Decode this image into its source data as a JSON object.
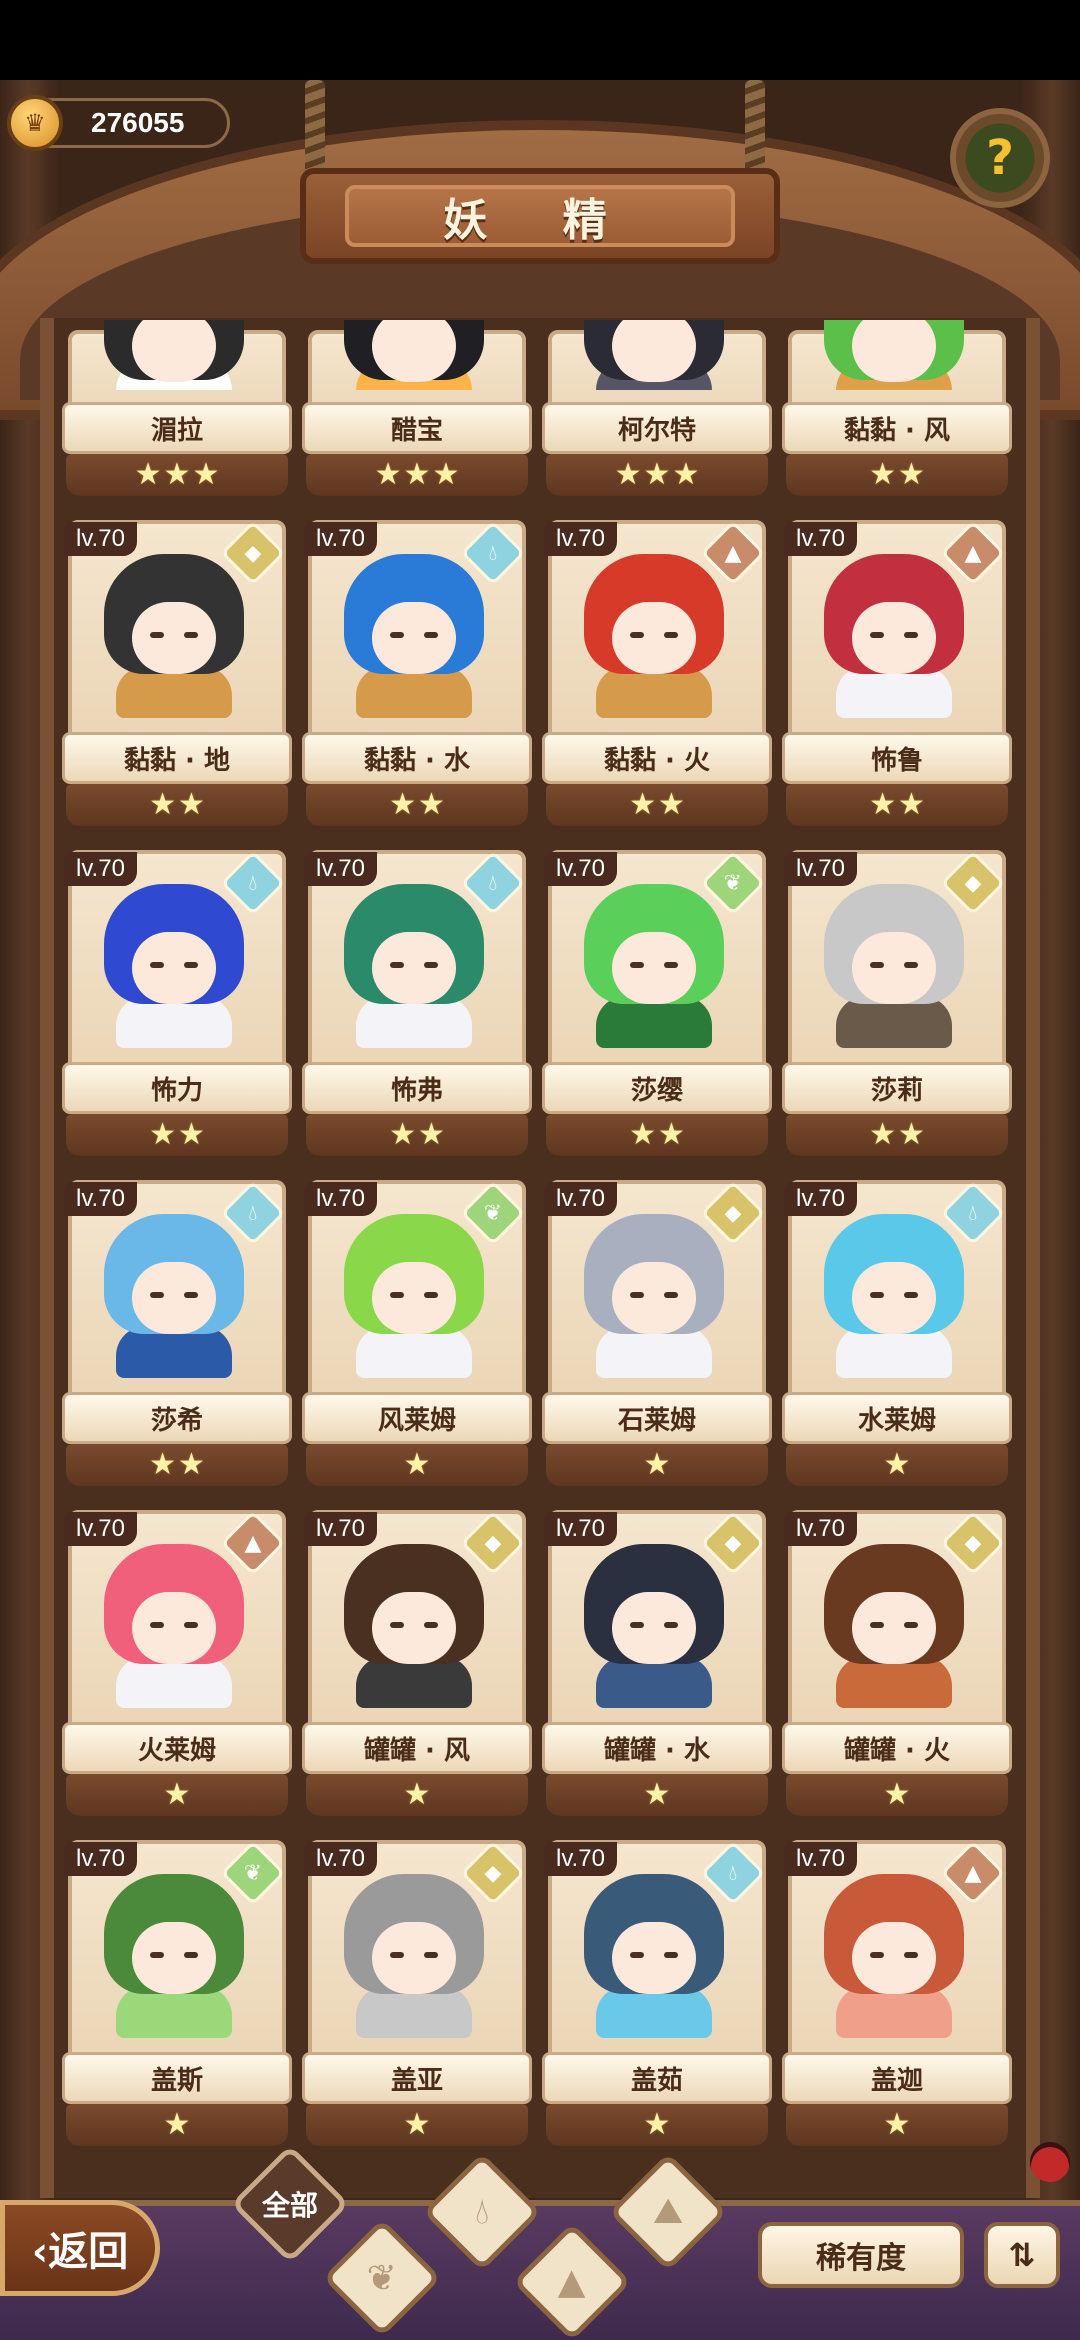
{
  "header": {
    "coins": "276055",
    "title": "妖 精",
    "help_label": "?"
  },
  "fairies": [
    {
      "name": "湄拉",
      "stars": 3,
      "partial": true,
      "hair": "#2b2b2b",
      "body": "#ffffff"
    },
    {
      "name": "醋宝",
      "stars": 3,
      "partial": true,
      "hair": "#1f1f24",
      "body": "#ffb347"
    },
    {
      "name": "柯尔特",
      "stars": 3,
      "partial": true,
      "hair": "#2b2b35",
      "body": "#555566"
    },
    {
      "name": "黏黏 · 风",
      "stars": 2,
      "partial": true,
      "hair": "#5cbf4a",
      "body": "#e0a04a"
    },
    {
      "name": "黏黏 · 地",
      "stars": 2,
      "level": "lv.70",
      "element": "earth",
      "hair": "#333333",
      "body": "#d59a4a"
    },
    {
      "name": "黏黏 · 水",
      "stars": 2,
      "level": "lv.70",
      "element": "water",
      "hair": "#2a7ad8",
      "body": "#d59a4a"
    },
    {
      "name": "黏黏 · 火",
      "stars": 2,
      "level": "lv.70",
      "element": "fire",
      "hair": "#d83a2a",
      "body": "#d59a4a"
    },
    {
      "name": "怖鲁",
      "stars": 2,
      "level": "lv.70",
      "element": "fire",
      "hair": "#c23040",
      "body": "#f4f4f8"
    },
    {
      "name": "怖力",
      "stars": 2,
      "level": "lv.70",
      "element": "water",
      "hair": "#2f4ad0",
      "body": "#f4f4f8"
    },
    {
      "name": "怖弗",
      "stars": 2,
      "level": "lv.70",
      "element": "water",
      "hair": "#2a8a6a",
      "body": "#f4f4f8"
    },
    {
      "name": "莎缨",
      "stars": 2,
      "level": "lv.70",
      "element": "wind",
      "hair": "#5ad05a",
      "body": "#2a7a3a"
    },
    {
      "name": "莎莉",
      "stars": 2,
      "level": "lv.70",
      "element": "earth",
      "hair": "#c8c8c8",
      "body": "#6a5a4a"
    },
    {
      "name": "莎希",
      "stars": 2,
      "level": "lv.70",
      "element": "water",
      "hair": "#6ab8e8",
      "body": "#2a5aa8"
    },
    {
      "name": "风莱姆",
      "stars": 1,
      "level": "lv.70",
      "element": "wind",
      "hair": "#8ad84a",
      "body": "#f4f4f8"
    },
    {
      "name": "石莱姆",
      "stars": 1,
      "level": "lv.70",
      "element": "earth",
      "hair": "#a8b0c0",
      "body": "#f4f4f8"
    },
    {
      "name": "水莱姆",
      "stars": 1,
      "level": "lv.70",
      "element": "water",
      "hair": "#5ac8e8",
      "body": "#f4f4f8"
    },
    {
      "name": "火莱姆",
      "stars": 1,
      "level": "lv.70",
      "element": "fire",
      "hair": "#f0607a",
      "body": "#f4f4f8"
    },
    {
      "name": "罐罐 · 风",
      "stars": 1,
      "level": "lv.70",
      "element": "earth",
      "hair": "#4a3020",
      "body": "#3a3a3a"
    },
    {
      "name": "罐罐 · 水",
      "stars": 1,
      "level": "lv.70",
      "element": "earth",
      "hair": "#2a3040",
      "body": "#3a5a8a"
    },
    {
      "name": "罐罐 · 火",
      "stars": 1,
      "level": "lv.70",
      "element": "earth",
      "hair": "#6a3a20",
      "body": "#c86a3a"
    },
    {
      "name": "盖斯",
      "stars": 1,
      "level": "lv.70",
      "element": "wind",
      "hair": "#4a8a3a",
      "body": "#9ad87a"
    },
    {
      "name": "盖亚",
      "stars": 1,
      "level": "lv.70",
      "element": "earth",
      "hair": "#9a9a9a",
      "body": "#c8c8c8"
    },
    {
      "name": "盖茹",
      "stars": 1,
      "level": "lv.70",
      "element": "water",
      "hair": "#3a5a7a",
      "body": "#6ac8e8"
    },
    {
      "name": "盖迦",
      "stars": 1,
      "level": "lv.70",
      "element": "fire",
      "hair": "#c85a3a",
      "body": "#f0a08a"
    }
  ],
  "bottom": {
    "back_label": "‹返回",
    "tab_all": "全部",
    "rarity_label": "稀有度",
    "sort_label": "⇅"
  }
}
